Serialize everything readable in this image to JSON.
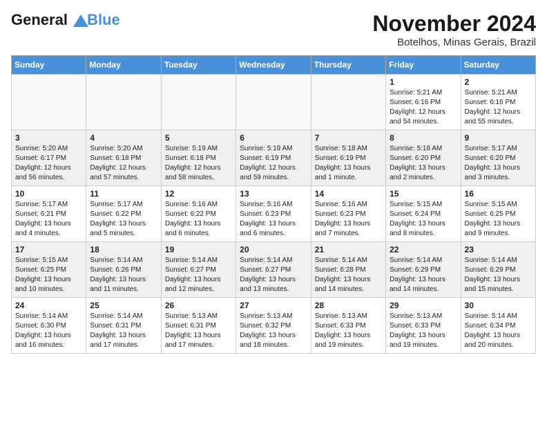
{
  "logo": {
    "line1": "General",
    "line2": "Blue"
  },
  "title": "November 2024",
  "location": "Botelhos, Minas Gerais, Brazil",
  "days_of_week": [
    "Sunday",
    "Monday",
    "Tuesday",
    "Wednesday",
    "Thursday",
    "Friday",
    "Saturday"
  ],
  "weeks": [
    [
      {
        "day": "",
        "info": ""
      },
      {
        "day": "",
        "info": ""
      },
      {
        "day": "",
        "info": ""
      },
      {
        "day": "",
        "info": ""
      },
      {
        "day": "",
        "info": ""
      },
      {
        "day": "1",
        "info": "Sunrise: 5:21 AM\nSunset: 6:16 PM\nDaylight: 12 hours\nand 54 minutes."
      },
      {
        "day": "2",
        "info": "Sunrise: 5:21 AM\nSunset: 6:16 PM\nDaylight: 12 hours\nand 55 minutes."
      }
    ],
    [
      {
        "day": "3",
        "info": "Sunrise: 5:20 AM\nSunset: 6:17 PM\nDaylight: 12 hours\nand 56 minutes."
      },
      {
        "day": "4",
        "info": "Sunrise: 5:20 AM\nSunset: 6:18 PM\nDaylight: 12 hours\nand 57 minutes."
      },
      {
        "day": "5",
        "info": "Sunrise: 5:19 AM\nSunset: 6:18 PM\nDaylight: 12 hours\nand 58 minutes."
      },
      {
        "day": "6",
        "info": "Sunrise: 5:19 AM\nSunset: 6:19 PM\nDaylight: 12 hours\nand 59 minutes."
      },
      {
        "day": "7",
        "info": "Sunrise: 5:18 AM\nSunset: 6:19 PM\nDaylight: 13 hours\nand 1 minute."
      },
      {
        "day": "8",
        "info": "Sunrise: 5:18 AM\nSunset: 6:20 PM\nDaylight: 13 hours\nand 2 minutes."
      },
      {
        "day": "9",
        "info": "Sunrise: 5:17 AM\nSunset: 6:20 PM\nDaylight: 13 hours\nand 3 minutes."
      }
    ],
    [
      {
        "day": "10",
        "info": "Sunrise: 5:17 AM\nSunset: 6:21 PM\nDaylight: 13 hours\nand 4 minutes."
      },
      {
        "day": "11",
        "info": "Sunrise: 5:17 AM\nSunset: 6:22 PM\nDaylight: 13 hours\nand 5 minutes."
      },
      {
        "day": "12",
        "info": "Sunrise: 5:16 AM\nSunset: 6:22 PM\nDaylight: 13 hours\nand 6 minutes."
      },
      {
        "day": "13",
        "info": "Sunrise: 5:16 AM\nSunset: 6:23 PM\nDaylight: 13 hours\nand 6 minutes."
      },
      {
        "day": "14",
        "info": "Sunrise: 5:16 AM\nSunset: 6:23 PM\nDaylight: 13 hours\nand 7 minutes."
      },
      {
        "day": "15",
        "info": "Sunrise: 5:15 AM\nSunset: 6:24 PM\nDaylight: 13 hours\nand 8 minutes."
      },
      {
        "day": "16",
        "info": "Sunrise: 5:15 AM\nSunset: 6:25 PM\nDaylight: 13 hours\nand 9 minutes."
      }
    ],
    [
      {
        "day": "17",
        "info": "Sunrise: 5:15 AM\nSunset: 6:25 PM\nDaylight: 13 hours\nand 10 minutes."
      },
      {
        "day": "18",
        "info": "Sunrise: 5:14 AM\nSunset: 6:26 PM\nDaylight: 13 hours\nand 11 minutes."
      },
      {
        "day": "19",
        "info": "Sunrise: 5:14 AM\nSunset: 6:27 PM\nDaylight: 13 hours\nand 12 minutes."
      },
      {
        "day": "20",
        "info": "Sunrise: 5:14 AM\nSunset: 6:27 PM\nDaylight: 13 hours\nand 13 minutes."
      },
      {
        "day": "21",
        "info": "Sunrise: 5:14 AM\nSunset: 6:28 PM\nDaylight: 13 hours\nand 14 minutes."
      },
      {
        "day": "22",
        "info": "Sunrise: 5:14 AM\nSunset: 6:29 PM\nDaylight: 13 hours\nand 14 minutes."
      },
      {
        "day": "23",
        "info": "Sunrise: 5:14 AM\nSunset: 6:29 PM\nDaylight: 13 hours\nand 15 minutes."
      }
    ],
    [
      {
        "day": "24",
        "info": "Sunrise: 5:14 AM\nSunset: 6:30 PM\nDaylight: 13 hours\nand 16 minutes."
      },
      {
        "day": "25",
        "info": "Sunrise: 5:14 AM\nSunset: 6:31 PM\nDaylight: 13 hours\nand 17 minutes."
      },
      {
        "day": "26",
        "info": "Sunrise: 5:13 AM\nSunset: 6:31 PM\nDaylight: 13 hours\nand 17 minutes."
      },
      {
        "day": "27",
        "info": "Sunrise: 5:13 AM\nSunset: 6:32 PM\nDaylight: 13 hours\nand 18 minutes."
      },
      {
        "day": "28",
        "info": "Sunrise: 5:13 AM\nSunset: 6:33 PM\nDaylight: 13 hours\nand 19 minutes."
      },
      {
        "day": "29",
        "info": "Sunrise: 5:13 AM\nSunset: 6:33 PM\nDaylight: 13 hours\nand 19 minutes."
      },
      {
        "day": "30",
        "info": "Sunrise: 5:14 AM\nSunset: 6:34 PM\nDaylight: 13 hours\nand 20 minutes."
      }
    ]
  ]
}
